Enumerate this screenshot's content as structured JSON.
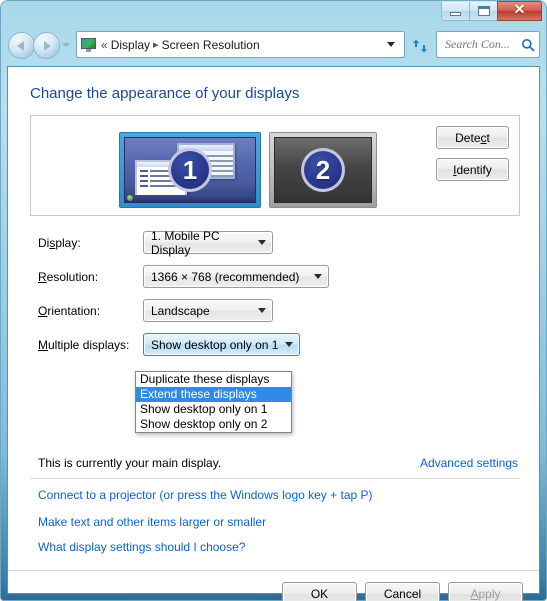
{
  "window": {
    "minimize_label": "Minimize",
    "maximize_label": "Maximize",
    "close_label": "Close"
  },
  "nav": {
    "back_label": "Back",
    "forward_label": "Forward",
    "recent_pages_label": "Recent pages",
    "breadcrumb_chevrons": "«",
    "breadcrumb_root": "Display",
    "breadcrumb_separator": "▸",
    "breadcrumb_current": "Screen Resolution",
    "refresh_label": "Refresh",
    "search_placeholder": "Search Con...",
    "search_value": ""
  },
  "main": {
    "title": "Change the appearance of your displays",
    "preview": {
      "monitor1_number": "1",
      "monitor2_number": "2",
      "detect_label": "Detect",
      "detect_accel": "c",
      "identify_label": "Identify",
      "identify_accel": "I"
    },
    "fields": [
      {
        "label": "Display:",
        "accel": "s",
        "value": "1. Mobile PC Display",
        "state": "normal"
      },
      {
        "label": "Resolution:",
        "accel": "R",
        "value": "1366 × 768 (recommended)",
        "state": "normal"
      },
      {
        "label": "Orientation:",
        "accel": "O",
        "value": "Landscape",
        "state": "normal"
      },
      {
        "label": "Multiple displays:",
        "accel": "M",
        "value": "Show desktop only on 1",
        "state": "active"
      }
    ],
    "dropdown": {
      "open": true,
      "options": [
        "Duplicate these displays",
        "Extend these displays",
        "Show desktop only on 1",
        "Show desktop only on 2"
      ],
      "selected_index": 1,
      "highlight_color": "#2f8ae8"
    },
    "main_display_note": "This is currently your main display.",
    "advanced_settings_link": "Advanced settings",
    "links": [
      "Connect to a projector (or press the  Windows logo key  + tap P)",
      "Make text and other items larger or smaller",
      "What display settings should I choose?"
    ]
  },
  "footer": {
    "ok_label": "OK",
    "cancel_label": "Cancel",
    "apply_label": "Apply",
    "apply_accel": "A",
    "apply_disabled": true
  },
  "colors": {
    "title_blue": "#15489e",
    "link_blue": "#0b63ce",
    "selection_blue": "#2f8ae8",
    "frame_blue": "#7fbcd9"
  }
}
